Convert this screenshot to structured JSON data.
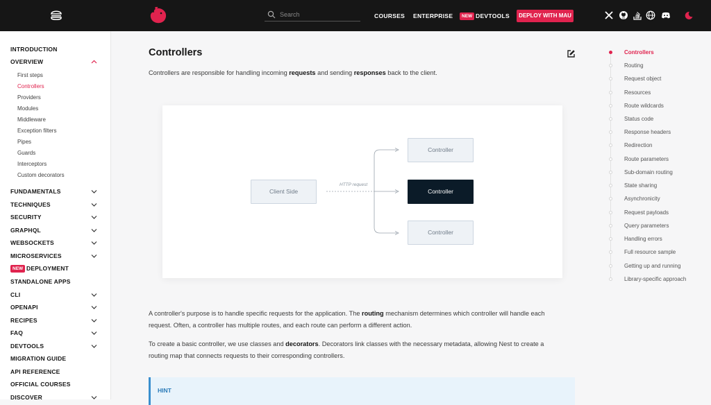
{
  "header": {
    "search_placeholder": "Search",
    "nav": [
      "COURSES",
      "ENTERPRISE",
      "DEVTOOLS"
    ],
    "new_badge": "NEW",
    "deploy_label": "DEPLOY WITH MAU",
    "icons": [
      "x-icon",
      "github-icon",
      "stackoverflow-icon",
      "globe-icon",
      "discord-icon",
      "theme-toggle-icon"
    ]
  },
  "sidebar": {
    "introduction": "INTRODUCTION",
    "overview": "OVERVIEW",
    "overview_items": [
      "First steps",
      "Controllers",
      "Providers",
      "Modules",
      "Middleware",
      "Exception filters",
      "Pipes",
      "Guards",
      "Interceptors",
      "Custom decorators"
    ],
    "sections": [
      {
        "label": "FUNDAMENTALS"
      },
      {
        "label": "TECHNIQUES"
      },
      {
        "label": "SECURITY"
      },
      {
        "label": "GRAPHQL"
      },
      {
        "label": "WEBSOCKETS"
      },
      {
        "label": "MICROSERVICES"
      },
      {
        "label": "DEPLOYMENT",
        "badge": "NEW"
      },
      {
        "label": "STANDALONE APPS"
      },
      {
        "label": "CLI"
      },
      {
        "label": "OPENAPI"
      },
      {
        "label": "RECIPES"
      },
      {
        "label": "FAQ"
      },
      {
        "label": "DEVTOOLS"
      },
      {
        "label": "MIGRATION GUIDE"
      },
      {
        "label": "API REFERENCE"
      },
      {
        "label": "OFFICIAL COURSES"
      },
      {
        "label": "DISCOVER"
      }
    ]
  },
  "content": {
    "title": "Controllers",
    "intro": {
      "a": "Controllers are responsible for handling incoming ",
      "b": "requests",
      "c": " and sending ",
      "d": "responses",
      "e": " back to the client."
    },
    "diagram": {
      "client": "Client Side",
      "http": "HTTP request",
      "controller": "Controller"
    },
    "p1": {
      "a": "A controller's purpose is to handle specific requests for the application. The ",
      "b": "routing",
      "c": " mechanism determines which controller will handle each request. Often, a controller has multiple routes, and each route can perform a different action."
    },
    "p2": {
      "a": "To create a basic controller, we use classes and ",
      "b": "decorators",
      "c": ". Decorators link classes with the necessary metadata, allowing Nest to create a routing map that connects requests to their corresponding controllers."
    },
    "hint": "HINT"
  },
  "toc": [
    "Controllers",
    "Routing",
    "Request object",
    "Resources",
    "Route wildcards",
    "Status code",
    "Response headers",
    "Redirection",
    "Route parameters",
    "Sub-domain routing",
    "State sharing",
    "Asynchronicity",
    "Request payloads",
    "Query parameters",
    "Handling errors",
    "Full resource sample",
    "Getting up and running",
    "Library-specific approach"
  ]
}
